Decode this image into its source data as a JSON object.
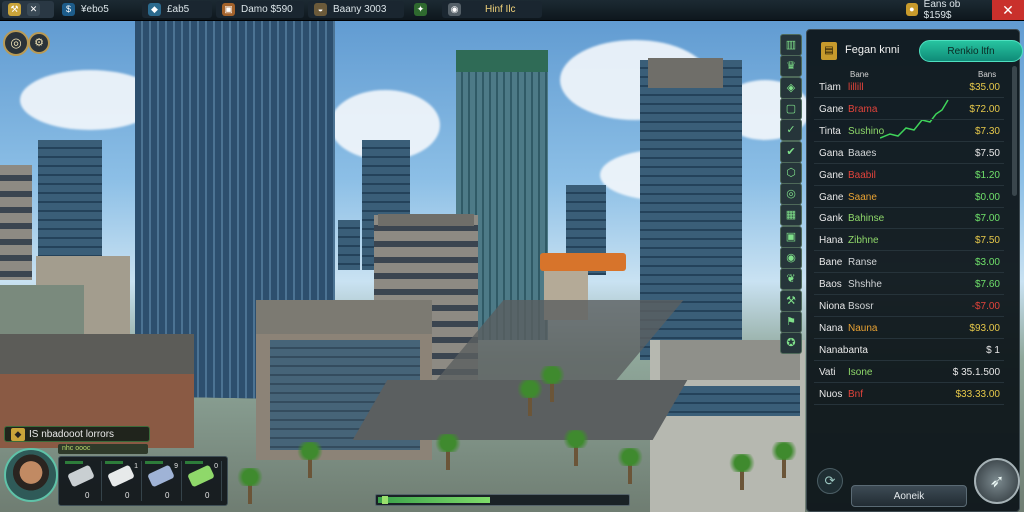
{
  "topbar": {
    "items": [
      {
        "icon": "tools-icon",
        "label": ""
      },
      {
        "icon": "money-icon",
        "label": "¥ebo5",
        "color": "#1d5c8a"
      },
      {
        "icon": "chip-icon",
        "label": "£ab5"
      },
      {
        "icon": "briefcase-icon",
        "label": "Damo  $590"
      },
      {
        "icon": "helmet-icon",
        "label": "Baany  3003"
      },
      {
        "icon": "leaf-icon",
        "label": ""
      },
      {
        "icon": "planet-icon",
        "label": "Hinf  Ilc"
      }
    ],
    "right_label": "Eans ob $159$",
    "close": "✕"
  },
  "market_panel": {
    "title": "Fegan knni",
    "action_button": "Renkio ltfn",
    "column_left": "Bane",
    "column_right": "Bans",
    "rows": [
      {
        "name": "Tiam",
        "ticker": "lillill",
        "value": "$35.00",
        "ticker_color": "#e2433b",
        "value_color": "#e6c84a"
      },
      {
        "name": "Gane",
        "ticker": "Brama",
        "value": "$72.00",
        "ticker_color": "#e2433b",
        "value_color": "#e6c84a"
      },
      {
        "name": "Tinta",
        "ticker": "Sushino",
        "value": "$7.30",
        "ticker_color": "#8fd86a",
        "value_color": "#e6c84a"
      },
      {
        "name": "Gana",
        "ticker": "Baaes",
        "value": "$7.50",
        "ticker_color": "#d0d4d6",
        "value_color": "#e6e6e6"
      },
      {
        "name": "Gane",
        "ticker": "Baabil",
        "value": "$1.20",
        "ticker_color": "#e2433b",
        "value_color": "#6fe06a"
      },
      {
        "name": "Gane",
        "ticker": "Saane",
        "value": "$0.00",
        "ticker_color": "#e8a233",
        "value_color": "#6fe06a"
      },
      {
        "name": "Gank",
        "ticker": "Bahinse",
        "value": "$7.00",
        "ticker_color": "#8fd86a",
        "value_color": "#6fe06a"
      },
      {
        "name": "Hana",
        "ticker": "Zibhne",
        "value": "$7.50",
        "ticker_color": "#8fd86a",
        "value_color": "#e6c84a"
      },
      {
        "name": "Bane",
        "ticker": "Ranse",
        "value": "$3.00",
        "ticker_color": "#d0d4d6",
        "value_color": "#6fe06a"
      },
      {
        "name": "Baos",
        "ticker": "Shshhe",
        "value": "$7.60",
        "ticker_color": "#d0d4d6",
        "value_color": "#6fe06a"
      },
      {
        "name": "Niona",
        "ticker": "Bsosr",
        "value": "-$7.00",
        "ticker_color": "#d0d4d6",
        "value_color": "#e2433b"
      },
      {
        "name": "Nana",
        "ticker": "Nauna",
        "value": "$93.00",
        "ticker_color": "#e8a233",
        "value_color": "#e6c84a"
      },
      {
        "name": "Nanabanta",
        "ticker": "",
        "value": "$ 1",
        "ticker_color": "#d0d4d6",
        "value_color": "#e6e6e6"
      },
      {
        "name": "Vati",
        "ticker": "Isone",
        "value": "$ 35.1.500",
        "ticker_color": "#8fd86a",
        "value_color": "#e6e6e6"
      },
      {
        "name": "Nuos",
        "ticker": "Bnf",
        "value": "$33.33.00",
        "ticker_color": "#e2433b",
        "value_color": "#e6c84a"
      }
    ],
    "footer_button": "Aoneik",
    "refresh_icon": "refresh-icon",
    "compass_icon": "compass-icon"
  },
  "side_icons": [
    "chart-icon",
    "trophy-icon",
    "shield-icon",
    "card-icon",
    "cart-icon",
    "check-icon",
    "hex-icon",
    "target-icon",
    "grid-icon",
    "monitor-icon",
    "slot-icon",
    "leaf-icon",
    "wrench-icon",
    "hammer-icon",
    "badge-icon"
  ],
  "character": {
    "label": "IS nbadooot lorrors",
    "sub": "nhc oooc",
    "slots": [
      {
        "count": "0",
        "top": "",
        "color": "#c9cfd2"
      },
      {
        "count": "0",
        "top": "1",
        "color": "#e7eaea"
      },
      {
        "count": "0",
        "top": "9",
        "color": "#9fb3d6"
      },
      {
        "count": "0",
        "top": "0",
        "color": "#8fd86a"
      }
    ]
  },
  "progress": {
    "fraction": 0.45
  },
  "colors": {
    "accent": "#27c4a0",
    "gold": "#c79a2c"
  }
}
